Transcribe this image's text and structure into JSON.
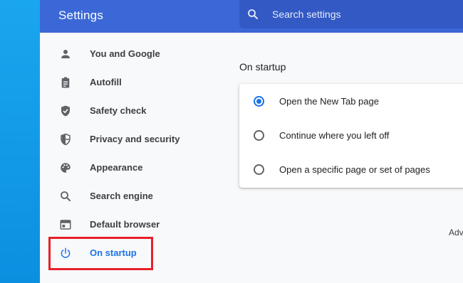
{
  "header": {
    "title": "Settings",
    "search_placeholder": "Search settings",
    "search_value": ""
  },
  "sidebar": {
    "items": [
      {
        "label": "You and Google",
        "icon": "person-icon",
        "active": false
      },
      {
        "label": "Autofill",
        "icon": "clipboard-icon",
        "active": false
      },
      {
        "label": "Safety check",
        "icon": "shield-check-icon",
        "active": false
      },
      {
        "label": "Privacy and security",
        "icon": "shield-half-icon",
        "active": false
      },
      {
        "label": "Appearance",
        "icon": "palette-icon",
        "active": false
      },
      {
        "label": "Search engine",
        "icon": "search-icon",
        "active": false
      },
      {
        "label": "Default browser",
        "icon": "browser-window-icon",
        "active": false
      },
      {
        "label": "On startup",
        "icon": "power-icon",
        "active": true
      }
    ]
  },
  "main": {
    "section_title": "On startup",
    "options": [
      {
        "label": "Open the New Tab page",
        "checked": true
      },
      {
        "label": "Continue where you left off",
        "checked": false
      },
      {
        "label": "Open a specific page or set of pages",
        "checked": false
      }
    ],
    "advanced_label": "Adv"
  },
  "colors": {
    "header": "#3b68d6",
    "accent": "#1a73e8",
    "highlight": "#e8202a",
    "desktop": "#0b8fe0"
  }
}
